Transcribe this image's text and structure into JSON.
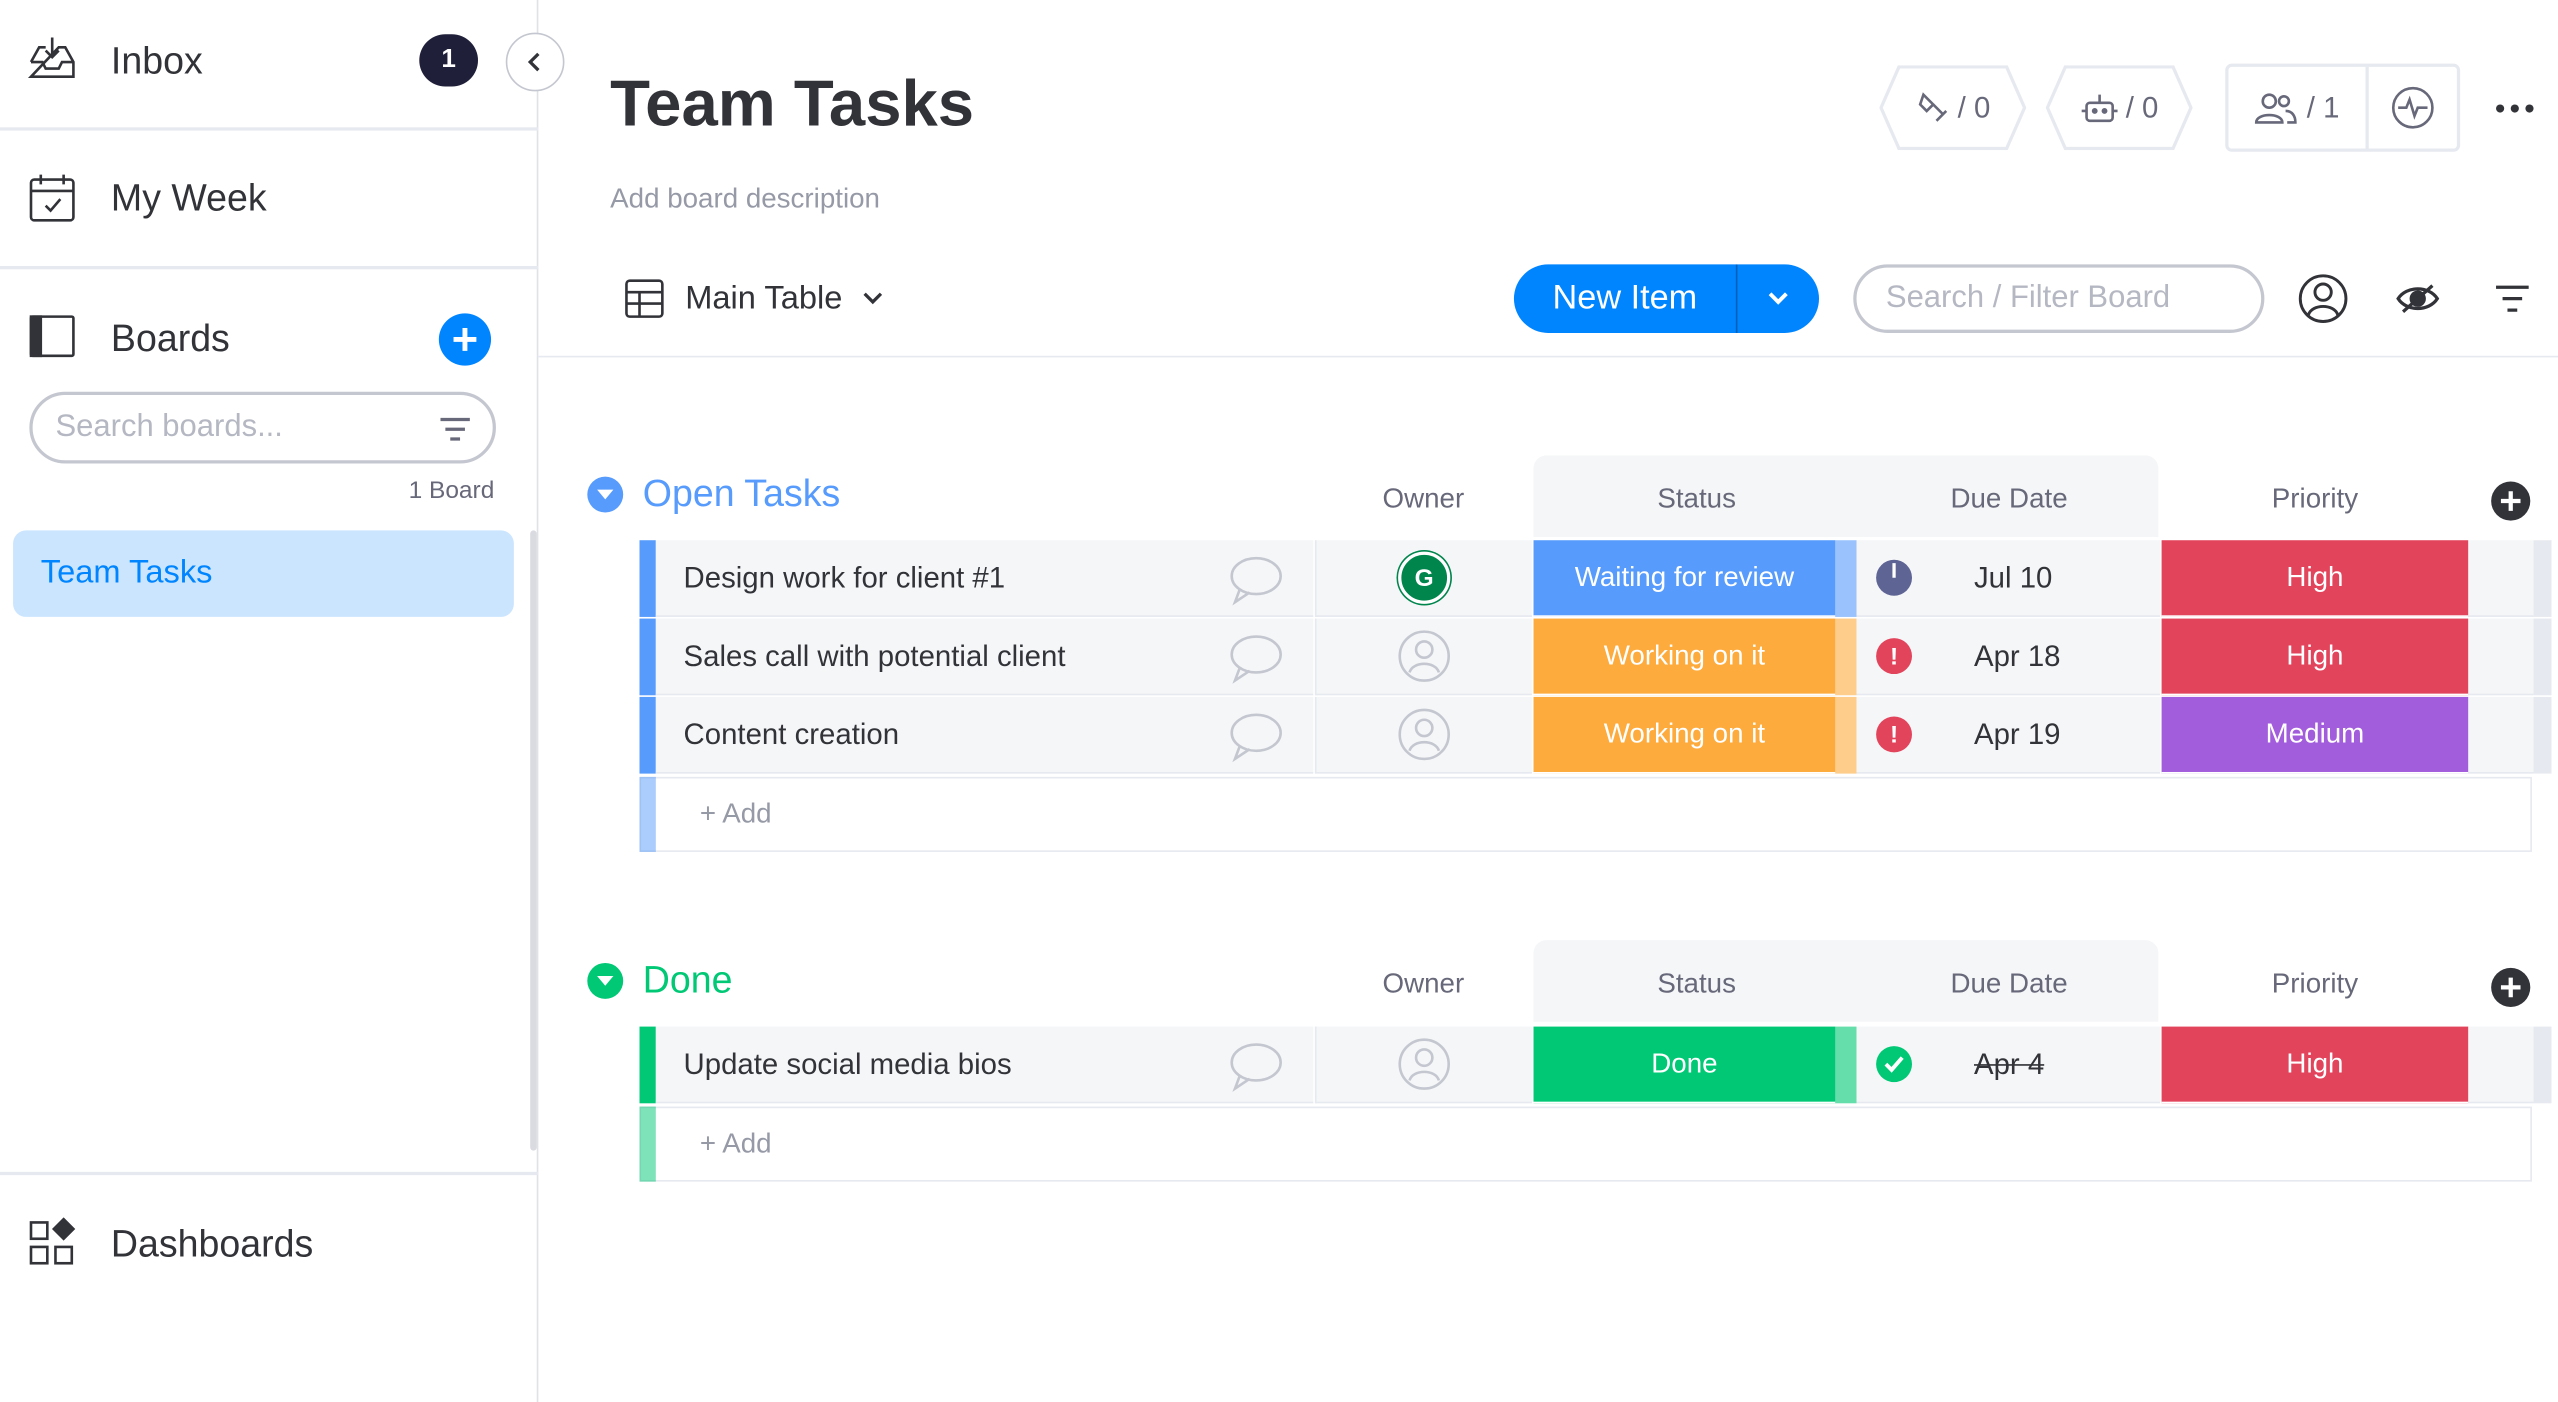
{
  "sidebar": {
    "inbox": {
      "label": "Inbox",
      "count": "1"
    },
    "my_week": {
      "label": "My Week"
    },
    "boards": {
      "label": "Boards",
      "search_placeholder": "Search boards...",
      "count_label": "1 Board",
      "items": [
        {
          "label": "Team Tasks"
        }
      ]
    },
    "dashboards": {
      "label": "Dashboards"
    }
  },
  "header": {
    "title": "Team Tasks",
    "description": "Add board description",
    "integrations_count": "/ 0",
    "automations_count": "/ 0",
    "members_count": "/ 1"
  },
  "toolbar": {
    "view_label": "Main Table",
    "new_item_label": "New Item",
    "search_placeholder": "Search / Filter Board"
  },
  "columns": {
    "owner": "Owner",
    "status": "Status",
    "due_date": "Due Date",
    "priority": "Priority"
  },
  "groups": [
    {
      "title": "Open Tasks",
      "color": "#579bfc",
      "add_label": "+ Add",
      "rows": [
        {
          "name": "Design work for client #1",
          "owner": "G",
          "status": "Waiting for review",
          "status_color": "#579bfc",
          "date": "Jul 10",
          "date_icon": "clock-icon",
          "priority": "High",
          "priority_color": "#e2445c"
        },
        {
          "name": "Sales call with potential client",
          "owner": "",
          "status": "Working on it",
          "status_color": "#fdab3d",
          "date": "Apr 18",
          "date_icon": "alert-icon",
          "priority": "High",
          "priority_color": "#e2445c"
        },
        {
          "name": "Content creation",
          "owner": "",
          "status": "Working on it",
          "status_color": "#fdab3d",
          "date": "Apr 19",
          "date_icon": "alert-icon",
          "priority": "Medium",
          "priority_color": "#a25ddc"
        }
      ]
    },
    {
      "title": "Done",
      "color": "#00c875",
      "add_label": "+ Add",
      "rows": [
        {
          "name": "Update social media bios",
          "owner": "",
          "status": "Done",
          "status_color": "#00c875",
          "date": "Apr 4",
          "date_icon": "check-icon",
          "priority": "High",
          "priority_color": "#e2445c"
        }
      ]
    }
  ]
}
